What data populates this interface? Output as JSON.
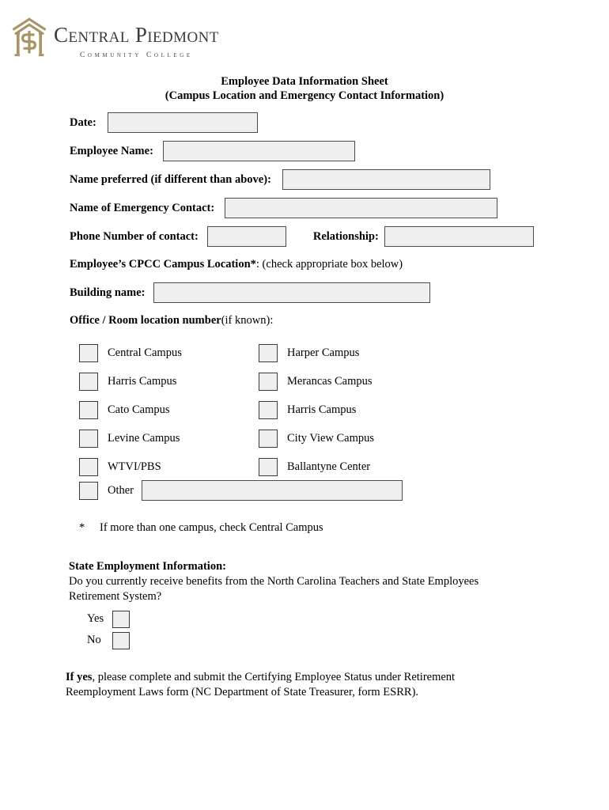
{
  "logo": {
    "mark_icon": "cpcc-house-monogram-icon",
    "primary_text": "Central Piedmont",
    "secondary_text": "Community College",
    "mark_color": "#a89464",
    "word_color": "#3b3b3f"
  },
  "title": {
    "line1": "Employee Data Information Sheet",
    "line2": "(Campus Location and Emergency Contact Information)"
  },
  "fields": {
    "date_label": "Date:",
    "date_value": "",
    "employee_name_label": "Employee Name:",
    "employee_name_value": "",
    "name_preferred_label": "Name preferred (if different than above):",
    "name_preferred_value": "",
    "emergency_contact_label": "Name of Emergency Contact:",
    "emergency_contact_value": "",
    "phone_label": "Phone Number of contact:",
    "phone_value": "",
    "relationship_label": "Relationship:",
    "relationship_value": "",
    "building_label": "Building name:",
    "building_value": "",
    "other_label": "Other",
    "other_value": ""
  },
  "campus_section": {
    "heading_bold": "Employee’s CPCC Campus Location*",
    "heading_rest": ": (check appropriate box below)",
    "room_bold": "Office / Room location number",
    "room_rest": " (if known):",
    "footnote_star": "*",
    "footnote_text": "If more than one campus, check Central Campus",
    "checkboxes": [
      {
        "col1": "Central Campus",
        "col2": "Harper Campus"
      },
      {
        "col1": "Harris Campus",
        "col2": "Merancas Campus"
      },
      {
        "col1": "Cato Campus",
        "col2": "Harris Campus"
      },
      {
        "col1": "Levine Campus",
        "col2": "City View Campus"
      },
      {
        "col1": "WTVI/PBS",
        "col2": "Ballantyne Center"
      }
    ]
  },
  "state_employment": {
    "heading": "State Employment Information:",
    "question_line1": "Do you currently receive benefits from the North Carolina Teachers and State Employees",
    "question_line2": "Retirement System?",
    "yes_label": "Yes",
    "no_label": "No"
  },
  "closing": {
    "bold_lead": "If yes",
    "text_line1": ", please complete and submit the Certifying Employee Status under Retirement",
    "text_line2": "Reemployment Laws form (NC Department of State Treasurer, form ESRR)."
  }
}
